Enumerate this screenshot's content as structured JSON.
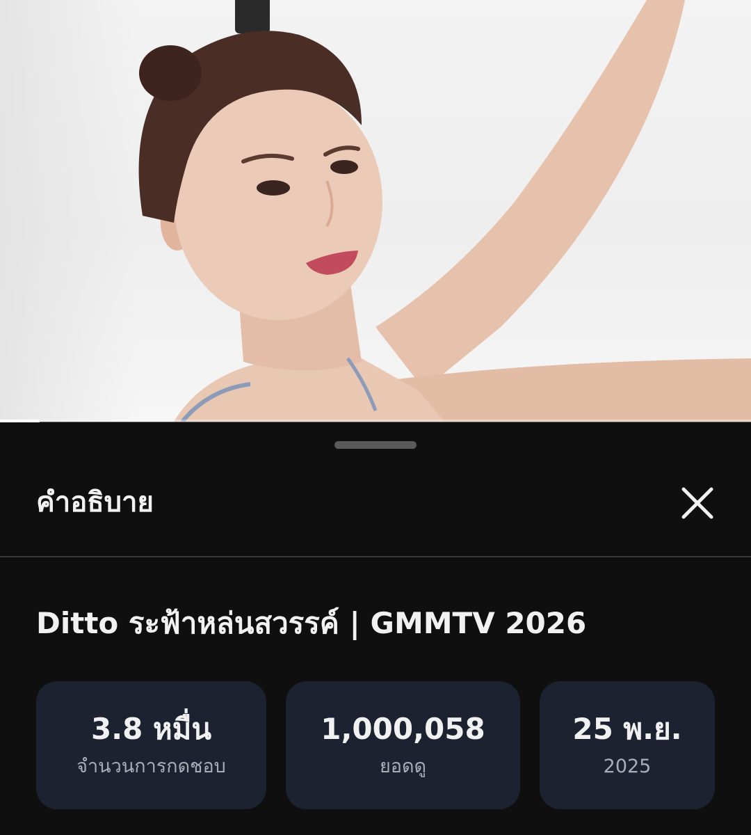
{
  "player": {
    "progress_fraction": 0.053
  },
  "sheet": {
    "header_title": "คำอธิบาย",
    "close_icon": "close-icon",
    "video_title": "Ditto ระฟ้าหล่นสวรรค์ | GMMTV 2026",
    "stats": [
      {
        "value": "3.8 หมื่น",
        "label": "จำนวนการกดชอบ"
      },
      {
        "value": "1,000,058",
        "label": "ยอดดู"
      },
      {
        "value": "25 พ.ย.",
        "label": "2025"
      }
    ]
  },
  "colors": {
    "sheet_background": "#0f0f0f",
    "stat_card_background": "#1c2230",
    "primary_text": "#f1f1f1",
    "secondary_text": "#a8adb6"
  }
}
